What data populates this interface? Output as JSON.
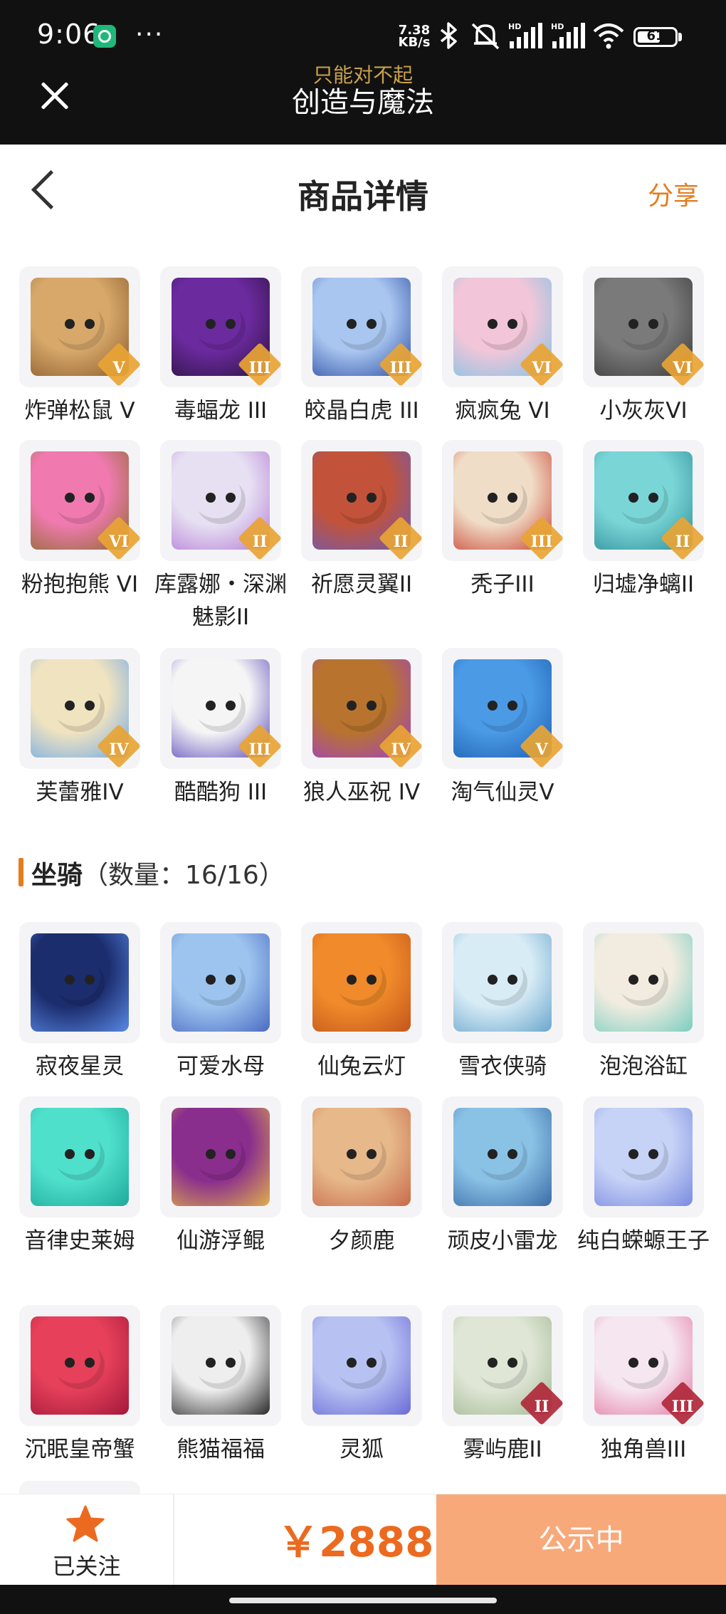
{
  "status_bar": {
    "time": "9:06",
    "dots": "···",
    "net_speed_value": "7.38",
    "net_speed_unit": "KB/s",
    "battery": "61",
    "battery_level": 0.61,
    "icons": [
      "notification-app-icon",
      "bluetooth-icon",
      "mute-icon",
      "hd-signal-icon",
      "hd-signal-icon",
      "wifi-icon",
      "battery-icon"
    ]
  },
  "app_header": {
    "title": "创造与魔法",
    "subtitle": "只能对不起",
    "close_icon": "close-icon"
  },
  "nav": {
    "back_icon": "back-arrow-icon",
    "title": "商品详情",
    "share": "分享"
  },
  "pets": [
    {
      "name": "炸弹松鼠 V",
      "rank": "V",
      "rank_color": "#e8a434",
      "art": [
        "#d7a86a",
        "#8a5a2b"
      ]
    },
    {
      "name": "毒蝠龙 III",
      "rank": "III",
      "rank_color": "#e8a434",
      "art": [
        "#6b2a9e",
        "#2a123d"
      ]
    },
    {
      "name": "皎晶白虎 III",
      "rank": "III",
      "rank_color": "#e8a434",
      "art": [
        "#a9c6f0",
        "#2a4ca3"
      ]
    },
    {
      "name": "疯疯兔 VI",
      "rank": "VI",
      "rank_color": "#e8a434",
      "art": [
        "#f2c6d8",
        "#7fc2e6"
      ]
    },
    {
      "name": "小灰灰VI",
      "rank": "VI",
      "rank_color": "#e8a434",
      "art": [
        "#7a7a7a",
        "#3a3a3a"
      ]
    },
    {
      "name": "粉抱抱熊 VI",
      "rank": "VI",
      "rank_color": "#e8a434",
      "art": [
        "#f07ab0",
        "#8a6a2a"
      ]
    },
    {
      "name": "库露娜・深渊魅影II",
      "rank": "II",
      "rank_color": "#e8a434",
      "art": [
        "#e6e0f2",
        "#b57ad6"
      ]
    },
    {
      "name": "祈愿灵翼II",
      "rank": "II",
      "rank_color": "#e8a434",
      "art": [
        "#c2533a",
        "#6a5ab8"
      ]
    },
    {
      "name": "秃子III",
      "rank": "III",
      "rank_color": "#e8a434",
      "art": [
        "#f0ddc8",
        "#c8402e"
      ]
    },
    {
      "name": "归墟净螭II",
      "rank": "II",
      "rank_color": "#e8a434",
      "art": [
        "#7ad6d6",
        "#2e8c9a"
      ]
    },
    {
      "name": "芙蕾雅IV",
      "rank": "IV",
      "rank_color": "#e8a434",
      "art": [
        "#f0e3c0",
        "#6fa8e6"
      ]
    },
    {
      "name": "酷酷狗 III",
      "rank": "III",
      "rank_color": "#e8a434",
      "art": [
        "#f5f5f5",
        "#5a46b8"
      ]
    },
    {
      "name": "狼人巫祝 IV",
      "rank": "IV",
      "rank_color": "#e8a434",
      "art": [
        "#b8742e",
        "#a23ec8"
      ]
    },
    {
      "name": "淘气仙灵V",
      "rank": "V",
      "rank_color": "#e8a434",
      "art": [
        "#4a9ae6",
        "#1c5fb0"
      ]
    }
  ],
  "mounts_section": {
    "title": "坐骑",
    "count": "（数量：16/16）"
  },
  "mounts": [
    {
      "name": "寂夜星灵",
      "rank": "",
      "rank_color": "",
      "art": [
        "#1c2d6e",
        "#5a8ae6"
      ]
    },
    {
      "name": "可爱水母",
      "rank": "",
      "rank_color": "",
      "art": [
        "#9cc4ee",
        "#4a6ac2"
      ]
    },
    {
      "name": "仙兔云灯",
      "rank": "",
      "rank_color": "",
      "art": [
        "#f08a2a",
        "#c2561c"
      ]
    },
    {
      "name": "雪衣侠骑",
      "rank": "",
      "rank_color": "",
      "art": [
        "#d8ecf6",
        "#6aa6cc"
      ]
    },
    {
      "name": "泡泡浴缸",
      "rank": "",
      "rank_color": "",
      "art": [
        "#f2ece0",
        "#7acdc0"
      ]
    },
    {
      "name": "音律史莱姆",
      "rank": "",
      "rank_color": "",
      "art": [
        "#4fe0cc",
        "#1ea89a"
      ]
    },
    {
      "name": "仙游浮鲲",
      "rank": "",
      "rank_color": "",
      "art": [
        "#8a2e8e",
        "#e0b04a"
      ]
    },
    {
      "name": "夕颜鹿",
      "rank": "",
      "rank_color": "",
      "art": [
        "#e6b88a",
        "#c86a4a"
      ]
    },
    {
      "name": "顽皮小雷龙",
      "rank": "",
      "rank_color": "",
      "art": [
        "#8ac2e6",
        "#3a6aa6"
      ]
    },
    {
      "name": "纯白蝾螈王子",
      "rank": "",
      "rank_color": "",
      "art": [
        "#c6d2f6",
        "#7a8ae0"
      ]
    },
    {
      "name": "沉眠皇帝蟹",
      "rank": "",
      "rank_color": "",
      "art": [
        "#e6405a",
        "#a2183a"
      ]
    },
    {
      "name": "熊猫福福",
      "rank": "",
      "rank_color": "",
      "art": [
        "#eeeeee",
        "#2a2a2a"
      ]
    },
    {
      "name": "灵狐",
      "rank": "",
      "rank_color": "",
      "art": [
        "#b8c2f2",
        "#6a6ad6"
      ]
    },
    {
      "name": "雾屿鹿II",
      "rank": "II",
      "rank_color": "#b0283a",
      "art": [
        "#dfe6d6",
        "#a2b892"
      ]
    },
    {
      "name": "独角兽III",
      "rank": "III",
      "rank_color": "#b0283a",
      "art": [
        "#f6e6f0",
        "#e47aa6"
      ]
    }
  ],
  "bottom_bar": {
    "follow_icon": "star-icon",
    "follow_label": "已关注",
    "price": "￥2888",
    "status_button": "公示中",
    "accent_color": "#ec6a1f"
  }
}
